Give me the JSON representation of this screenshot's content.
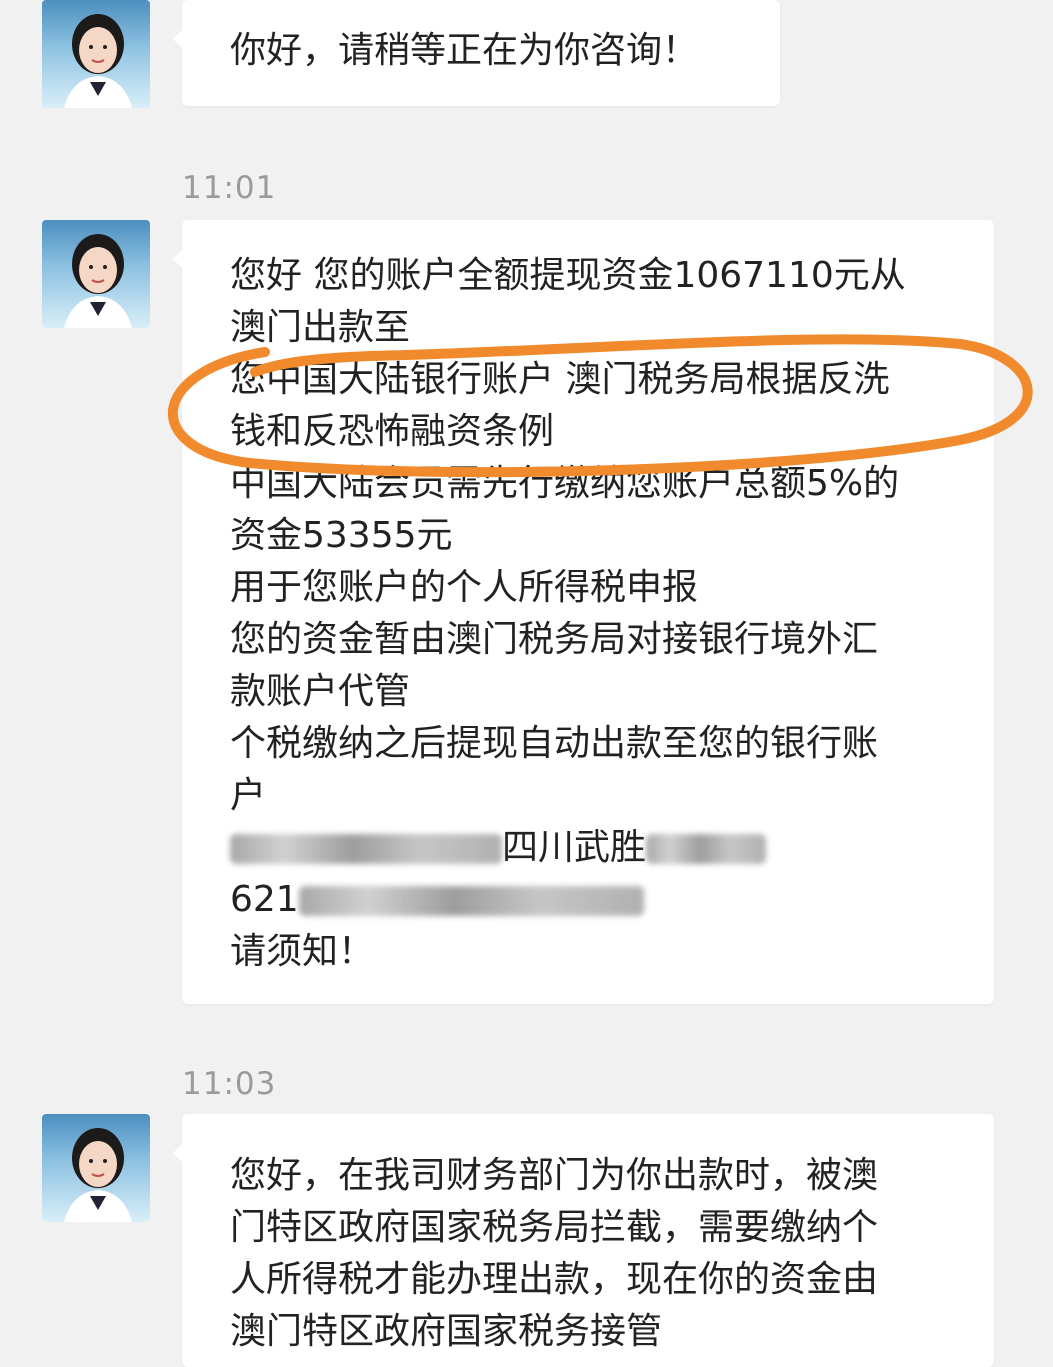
{
  "messages": [
    {
      "text_lines": [
        "你好，请稍等正在为你咨询！"
      ]
    },
    {
      "timestamp": "11:01",
      "text_lines": [
        "您好 您的账户全额提现资金1067110元从",
        "澳门出款至",
        "您中国大陆银行账户 澳门税务局根据反洗",
        "钱和反恐怖融资条例",
        "中国大陆会员需先行缴纳您账户总额5%的",
        "资金53355元",
        "用于您账户的个人所得税申报",
        "您的资金暂由澳门税务局对接银行境外汇",
        "款账户代管",
        "个税缴纳之后提现自动出款至您的银行账",
        "户"
      ],
      "bank_name_visible": "四川武胜",
      "account_prefix": "621",
      "closing": "请须知！"
    },
    {
      "timestamp": "11:03",
      "text_lines": [
        "您好，在我司财务部门为你出款时，被澳",
        "门特区政府国家税务局拦截，需要缴纳个",
        "人所得税才能办理出款，现在你的资金由",
        "澳门特区政府国家税务接管"
      ]
    }
  ],
  "colors": {
    "background": "#f1f1f1",
    "bubble": "#ffffff",
    "text": "#222222",
    "timestamp": "#9a9a9a",
    "annotation_stroke": "#f08a2c"
  },
  "icons": {
    "avatar": "agent-avatar-icon"
  }
}
